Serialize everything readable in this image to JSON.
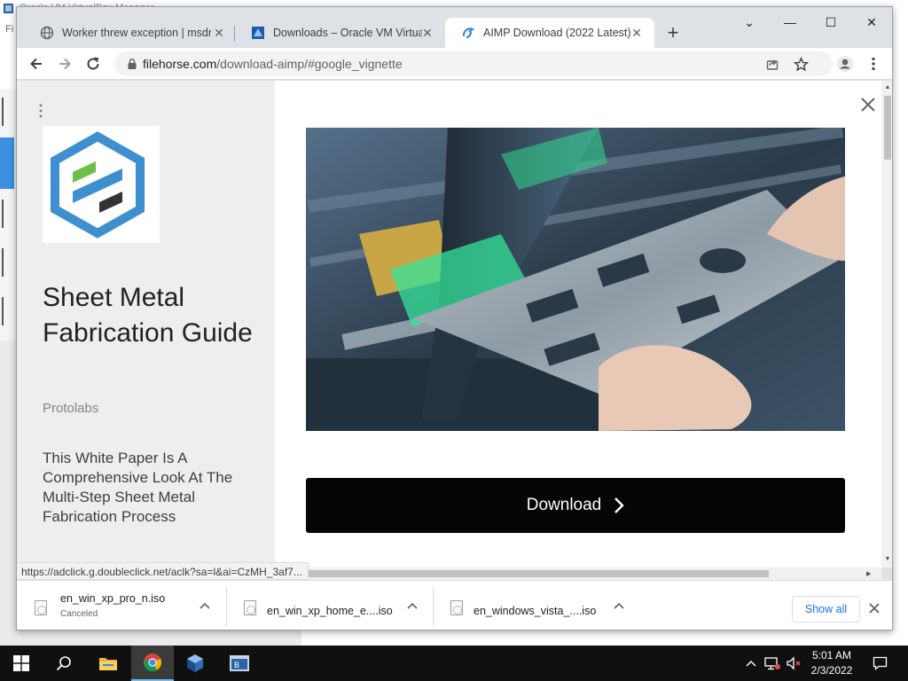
{
  "background_window": {
    "title": "Oracle VM VirtualBox Manager",
    "menu_text": "Fi"
  },
  "tabs": [
    {
      "title": "Worker threw exception | msdn.M",
      "icon": "globe-icon",
      "active": false
    },
    {
      "title": "Downloads – Oracle VM VirtualB",
      "icon": "virtualbox-icon",
      "active": false
    },
    {
      "title": "AIMP Download (2022 Latest)",
      "icon": "filehorse-icon",
      "active": true
    }
  ],
  "window_controls": {
    "minimize": "—",
    "maximize": "☐",
    "close": "✕",
    "tab_search": "⌄"
  },
  "address_bar": {
    "host": "filehorse.com",
    "path": "/download-aimp/#google_vignette"
  },
  "ad": {
    "headline": "Sheet Metal Fabrication Guide",
    "brand": "Protolabs",
    "body": "This White Paper Is A Comprehensive Look At The Multi-Step Sheet Metal Fabrication Process",
    "download_label": "Download",
    "accent_color": "#3d8fcf",
    "accent_green": "#6cc04a"
  },
  "status_url": "https://adclick.g.doubleclick.net/aclk?sa=l&ai=CzMH_3af7...",
  "downloads": [
    {
      "name": "en_win_xp_pro_n.iso",
      "status": "Canceled"
    },
    {
      "name": "en_win_xp_home_e....iso",
      "status": ""
    },
    {
      "name": "en_windows_vista_....iso",
      "status": ""
    }
  ],
  "shelf": {
    "show_all": "Show all"
  },
  "taskbar": {
    "time": "5:01 AM",
    "date": "2/3/2022",
    "apps": [
      "windows-start-icon",
      "search-icon",
      "file-explorer-icon",
      "chrome-icon",
      "virtualbox-icon",
      "vbox-manager-icon"
    ]
  }
}
